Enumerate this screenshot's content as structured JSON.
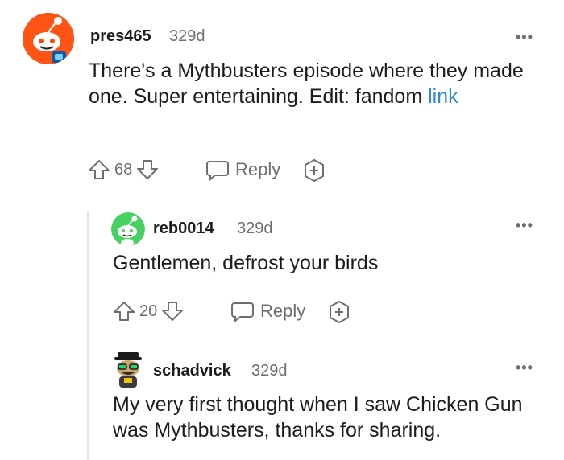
{
  "comments": [
    {
      "username": "pres465",
      "age": "329d",
      "body": "There's a Mythbusters episode where they made one. Super entertaining. Edit: fandom",
      "link_text": "link",
      "votes": "68",
      "reply_label": "Reply",
      "menu": "•••"
    },
    {
      "username": "reb0014",
      "age": "329d",
      "body": "Gentlemen, defrost your birds",
      "votes": "20",
      "reply_label": "Reply",
      "menu": "•••"
    },
    {
      "username": "schadvick",
      "age": "329d",
      "body": "My very first thought when I saw Chicken Gun was Mythbusters, thanks for sharing.",
      "menu": "•••"
    }
  ],
  "colors": {
    "text": "#1c1c1c",
    "meta": "#6e6e6e",
    "link": "#2e8ad8",
    "avatar_orange": "#ff4500",
    "avatar_green": "#46d160"
  },
  "icons": [
    "upvote-icon",
    "downvote-icon",
    "reply-icon",
    "award-icon",
    "more-icon"
  ]
}
